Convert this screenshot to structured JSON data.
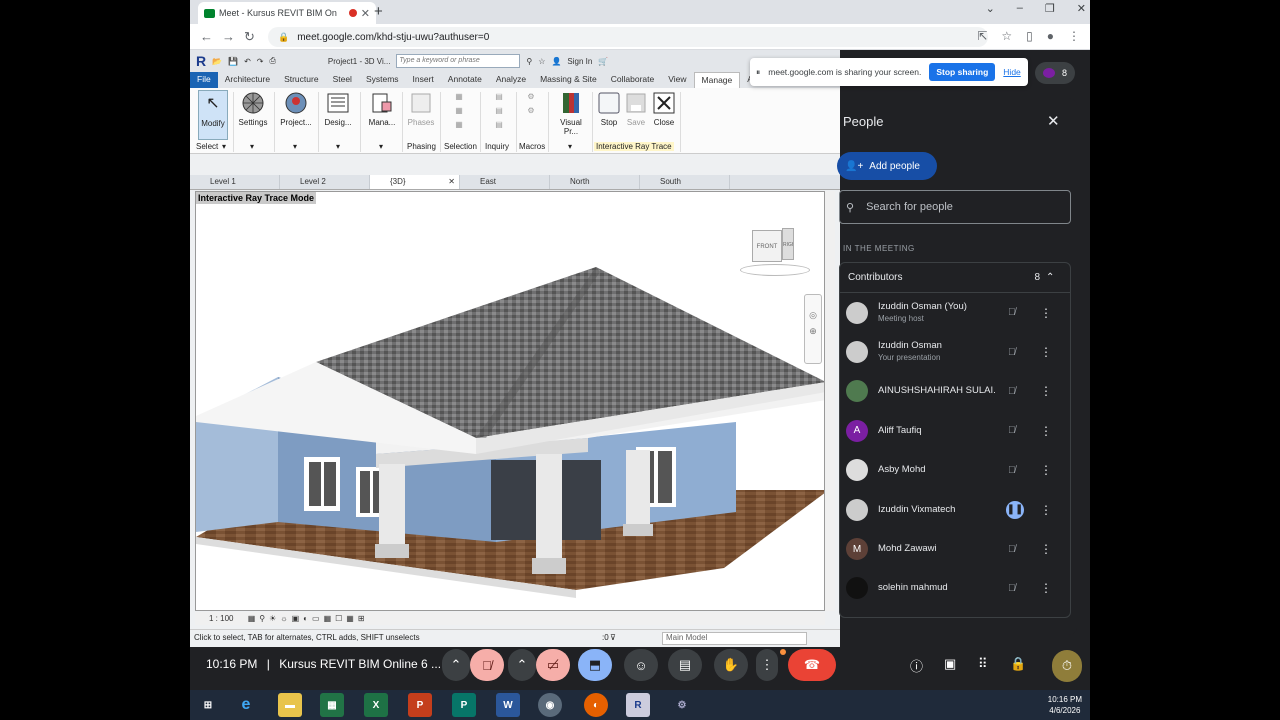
{
  "browser": {
    "tab_title": "Meet - Kursus REVIT BIM On",
    "url": "meet.google.com/khd-stju-uwu?authuser=0"
  },
  "revit": {
    "project_title": "Project1 - 3D Vi...",
    "keyword_placeholder": "Type a keyword or phrase",
    "sign_in": "Sign In",
    "tabs": [
      "File",
      "Architecture",
      "Structure",
      "Steel",
      "Systems",
      "Insert",
      "Annotate",
      "Analyze",
      "Massing & Site",
      "Collaborate",
      "View",
      "Manage",
      "A"
    ],
    "active_tab": "Manage",
    "buttons": {
      "modify": "Modify",
      "settings": "Settings",
      "project": "Project...",
      "design": "Desig...",
      "manage": "Mana...",
      "phases": "Phases",
      "visual": "Visual Pr...",
      "stop": "Stop",
      "save": "Save",
      "close": "Close"
    },
    "panels": {
      "select": "Select",
      "phasing": "Phasing",
      "selection": "Selection",
      "inquiry": "Inquiry",
      "macros": "Macros",
      "irt": "Interactive Ray Trace"
    },
    "view_tabs": [
      "Level 1",
      "Level 2",
      "{3D}",
      "East",
      "North",
      "South"
    ],
    "active_view": "{3D}",
    "mode_label": "Interactive Ray Trace Mode",
    "viewcube": {
      "front": "FRONT",
      "right": "RIGH"
    },
    "scale": "1 : 100",
    "status": "Click to select, TAB for alternates, CTRL adds, SHIFT unselects",
    "selection_count": ":0",
    "model": "Main Model"
  },
  "share": {
    "text": "meet.google.com is sharing your screen.",
    "stop": "Stop sharing",
    "hide": "Hide"
  },
  "meet": {
    "participant_count": "8",
    "panel_title": "People",
    "add_people": "Add people",
    "search_placeholder": "Search for people",
    "in_meeting": "IN THE MEETING",
    "contributors": "Contributors",
    "contributors_count": "8",
    "participants": [
      {
        "name": "Izuddin Osman (You)",
        "sub": "Meeting host",
        "avatar": "",
        "color": "#ccc"
      },
      {
        "name": "Izuddin Osman",
        "sub": "Your presentation",
        "avatar": "",
        "color": "#ccc"
      },
      {
        "name": "AINUSHSHAHIRAH SULAI...",
        "sub": "",
        "avatar": "",
        "color": "#4f7a4f"
      },
      {
        "name": "Aliff Taufiq",
        "sub": "",
        "avatar": "A",
        "color": "#7b1fa2"
      },
      {
        "name": "Asby Mohd",
        "sub": "",
        "avatar": "",
        "color": "#ddd"
      },
      {
        "name": "Izuddin Vixmatech",
        "sub": "",
        "avatar": "",
        "color": "#ccc"
      },
      {
        "name": "Mohd Zawawi",
        "sub": "",
        "avatar": "M",
        "color": "#5d4037"
      },
      {
        "name": "solehin mahmud",
        "sub": "",
        "avatar": "",
        "color": "#111"
      }
    ]
  },
  "call": {
    "time": "10:16 PM",
    "separator": "|",
    "meeting_name": "Kursus REVIT BIM Online 6 ..."
  },
  "taskbar": {
    "time": "10:16 PM",
    "date": "4/6/2026"
  },
  "colors": {
    "meet_bg": "#202124",
    "accent": "#1a73e8",
    "end_call": "#ea4335",
    "revit_file": "#1a64b4"
  }
}
